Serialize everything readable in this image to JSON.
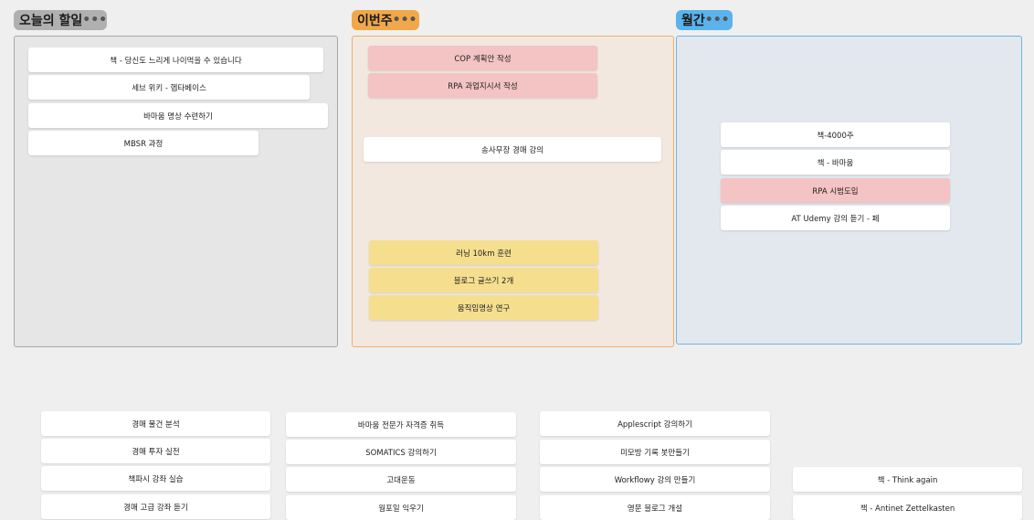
{
  "frames": [
    {
      "title": "오늘의 할일",
      "menu": "•••",
      "color": "#b0b0b0",
      "border": "#a8a8a8",
      "fill": "#e6e6e6"
    },
    {
      "title": "이번주",
      "menu": "•••",
      "color": "#f0a84a",
      "border": "#f0b06a",
      "fill": "#f2e8df"
    },
    {
      "title": "월간",
      "menu": "•••",
      "color": "#5ab3ec",
      "border": "#6cb7e8",
      "fill": "#e3e8ee"
    }
  ],
  "today_cards": [
    "책 - 당신도 느리게 나이먹을 수 있습니다",
    "세브 위키 - 헵타베이스",
    "바마움 명상 수련하기",
    "MBSR 과정"
  ],
  "week_cards": [
    {
      "text": "COP 계획안 작성",
      "style": "red"
    },
    {
      "text": "RPA 과업지시서 작성",
      "style": "red"
    },
    {
      "text": "송사무장 경매 강의",
      "style": "white"
    },
    {
      "text": "러닝 10km 훈련",
      "style": "yellow"
    },
    {
      "text": "블로그 글쓰기 2개",
      "style": "yellow"
    },
    {
      "text": "움직임명상 연구",
      "style": "yellow"
    }
  ],
  "month_cards": [
    {
      "text": "책-4000주",
      "style": "white"
    },
    {
      "text": "책 - 바마움",
      "style": "white"
    },
    {
      "text": "RPA 시범도입",
      "style": "red"
    },
    {
      "text": "AT Udemy 강의 듣기 - 페",
      "style": "white"
    }
  ],
  "backlog": {
    "col1": [
      "경매 물건 분석",
      "경매 투자 실전",
      "책파시 강좌 실습",
      "경매 고급 강좌 듣기"
    ],
    "col2": [
      "바마움 전문가 자격증 취득",
      "SOMATICS 강의하기",
      "고대운동",
      "웜포일 익우기"
    ],
    "col3": [
      "Applescript 강의하기",
      "미모방 기록 봇만들기",
      "Workflowy 강의 만들기",
      "영문 블로그 개설"
    ],
    "col4": [
      "책 - Think again",
      "책 - Antinet Zettelkasten"
    ]
  },
  "colors": {
    "red_card": "#f4c3c3",
    "yellow_card": "#f5df8f",
    "white_card": "#ffffff"
  }
}
